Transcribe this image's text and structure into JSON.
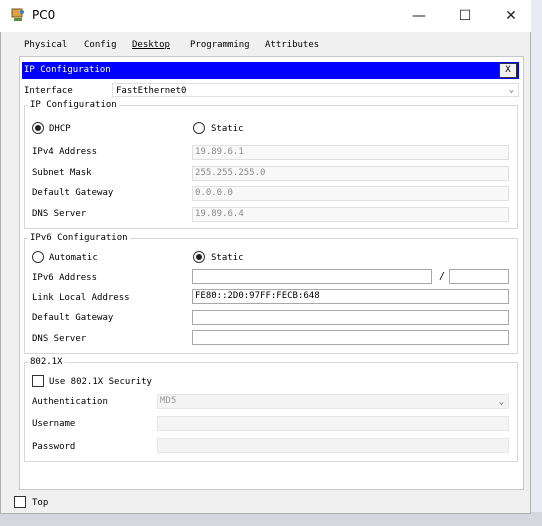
{
  "window": {
    "title": "PC0"
  },
  "tabs": [
    {
      "label": "Physical"
    },
    {
      "label": "Config"
    },
    {
      "label": "Desktop"
    },
    {
      "label": "Programming"
    },
    {
      "label": "Attributes"
    }
  ],
  "panel": {
    "header": "IP Configuration",
    "close_label": "X"
  },
  "interface": {
    "label": "Interface",
    "value": "FastEthernet0"
  },
  "ipv4": {
    "title": "IP Configuration",
    "dhcp_label": "DHCP",
    "static_label": "Static",
    "address_label": "IPv4 Address",
    "address_value": "19.89.6.1",
    "mask_label": "Subnet Mask",
    "mask_value": "255.255.255.0",
    "gateway_label": "Default Gateway",
    "gateway_value": "0.0.0.0",
    "dns_label": "DNS Server",
    "dns_value": "19.89.6.4"
  },
  "ipv6": {
    "title": "IPv6 Configuration",
    "automatic_label": "Automatic",
    "static_label": "Static",
    "address_label": "IPv6 Address",
    "address_value": "",
    "prefix_value": "",
    "slash": "/",
    "link_local_label": "Link Local Address",
    "link_local_value": "FE80::2D0:97FF:FECB:648",
    "gateway_label": "Default Gateway",
    "gateway_value": "",
    "dns_label": "DNS Server",
    "dns_value": ""
  },
  "dot1x": {
    "title": "802.1X",
    "use_label": "Use 802.1X Security",
    "auth_label": "Authentication",
    "auth_value": "MD5",
    "username_label": "Username",
    "username_value": "",
    "password_label": "Password",
    "password_value": ""
  },
  "footer": {
    "top_label": "Top"
  }
}
